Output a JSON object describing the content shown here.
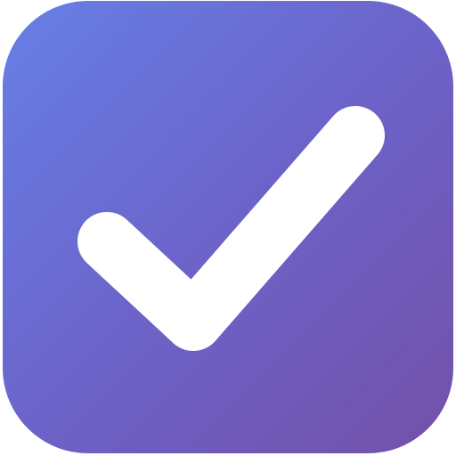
{
  "icon": {
    "name": "checkmark-icon",
    "colors": {
      "gradient_start": "#6680e6",
      "gradient_mid": "#6c63c9",
      "gradient_end": "#7350a8",
      "check": "#ffffff",
      "background": "#ffffff"
    }
  }
}
